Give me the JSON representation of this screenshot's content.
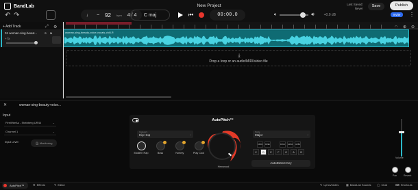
{
  "app": {
    "brand": "BandLab",
    "project_title": "New Project",
    "accent": "#2bb8c9"
  },
  "header": {
    "tempo": "92",
    "tempo_unit": "bpm",
    "time_signature": "4 / 4",
    "key": "C maj",
    "time": "00:00.0",
    "volume_db": "+0.0 dB",
    "saved_line1": "Last Saved:",
    "saved_line2": "Never",
    "save_label": "Save",
    "publish_label": "Publish",
    "invite_label": "Invite"
  },
  "tracks": {
    "add_label": "+ Add Track",
    "items": [
      {
        "name": "01 woman-sing-beaut...",
        "fx": "+ fx",
        "solo": "S",
        "mute": "M"
      }
    ]
  },
  "timeline": {
    "region_label": "woman-sing-beauty-voice-vocals-chill-R",
    "drop_icon": "⤓",
    "drop_text": "Drop a loop or an audio/MIDI/video file"
  },
  "editor": {
    "track_name": "woman-sing-beauty-voice...",
    "input_label": "Input",
    "device": "FireWireAu - Steinberg UR44",
    "channel": "Channel 1",
    "input_level_label": "Input Level",
    "monitoring_label": "Monitoring"
  },
  "autopitch": {
    "title": "AutoPitch™",
    "category_caption": "Category",
    "category_value": "Hip Hop",
    "presets": [
      {
        "label": "Modern Rap",
        "selected": true,
        "locked": false
      },
      {
        "label": "Boss",
        "selected": false,
        "locked": true
      },
      {
        "label": "Yummy",
        "selected": false,
        "locked": true
      },
      {
        "label": "Play Cool",
        "selected": false,
        "locked": true
      }
    ],
    "knob_label": "Hexwood",
    "scale_caption": "Scale",
    "scale_value": "Major",
    "black_keys": [
      "C#/Db",
      "D#/Eb",
      "F#/Gb",
      "G#/Ab",
      "A#/Bb"
    ],
    "white_keys": [
      "C",
      "D",
      "E",
      "F",
      "G",
      "A",
      "B"
    ],
    "selected_key": "D",
    "autodetect_label": "AutoDetect Key",
    "volume_label": "Volume",
    "pan_label": "Pan",
    "reverb_label": "Reverb"
  },
  "statusbar": {
    "autopitch_tab": "AutoPitch™",
    "effects": "Effects",
    "editor": "Editor",
    "lyrics": "Lyrics/Notes",
    "sounds": "BandLab Sounds",
    "chat": "Chat",
    "shortcuts": "Shortcuts"
  }
}
